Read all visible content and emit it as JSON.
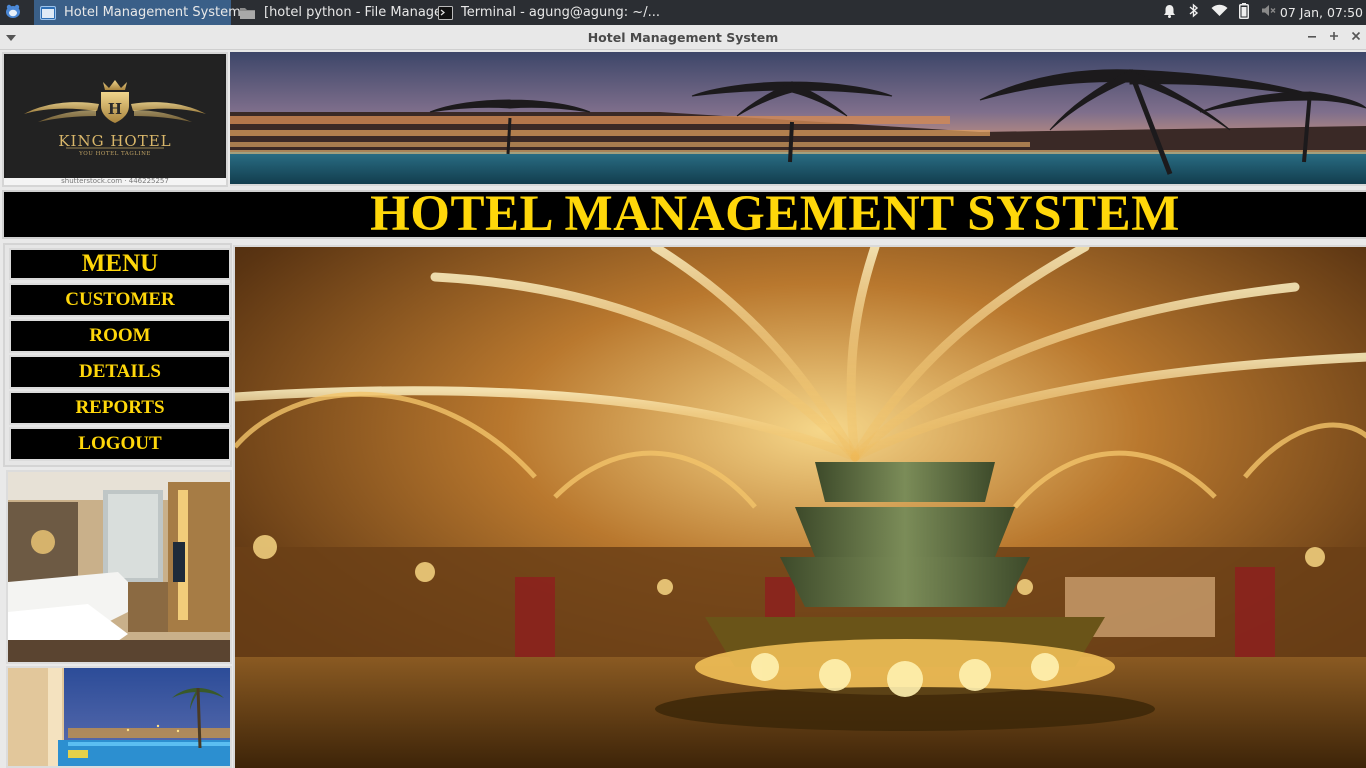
{
  "taskbar": {
    "launcher_icon": "xfce-mouse-icon",
    "tasks": [
      {
        "label": "Hotel Management System",
        "icon": "app-window-icon",
        "active": true
      },
      {
        "label": "[hotel python - File Manager]",
        "icon": "folder-icon",
        "active": false
      },
      {
        "label": "Terminal - agung@agung: ~/...",
        "icon": "terminal-icon",
        "active": false
      }
    ],
    "tray_icons": [
      "bell-icon",
      "bluetooth-icon",
      "wifi-icon",
      "battery-icon",
      "volume-muted-icon"
    ],
    "clock": "07 Jan, 07:50"
  },
  "window": {
    "title": "Hotel Management System",
    "menu_icon": "chevron-down-icon",
    "controls": [
      "minimize-icon",
      "maximize-icon",
      "close-icon"
    ]
  },
  "header": {
    "logo_name": "KING HOTEL",
    "logo_tagline": "YOU HOTEL TAGLINE",
    "logo_caption": "shutterstock.com · 446225257",
    "title": "HOTEL MANAGEMENT SYSTEM"
  },
  "menu": {
    "heading": "MENU",
    "items": [
      {
        "label": "CUSTOMER"
      },
      {
        "label": "ROOM"
      },
      {
        "label": "DETAILS"
      },
      {
        "label": "REPORTS"
      },
      {
        "label": "LOGOUT"
      }
    ]
  },
  "colors": {
    "accent_yellow": "#ffd70a",
    "panel_black": "#000000",
    "taskbar": "#2b2e33",
    "active_task": "#3a5f88"
  }
}
